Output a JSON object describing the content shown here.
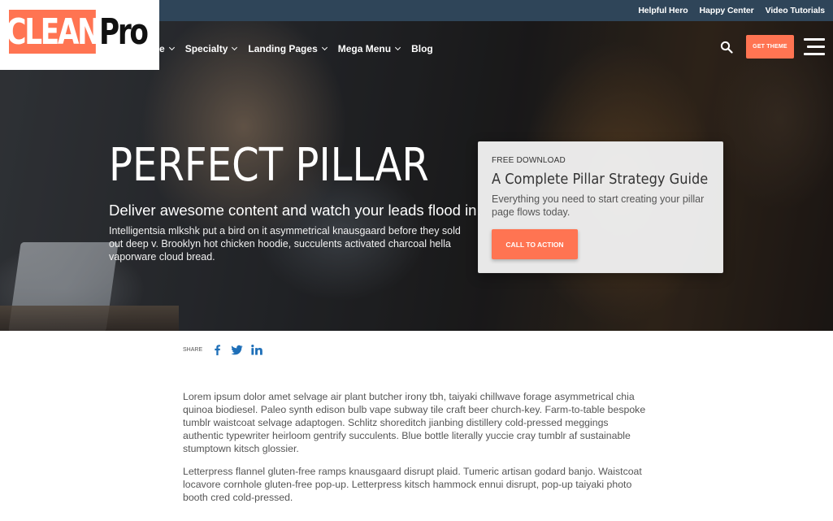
{
  "brand": {
    "logo_clean": "CLEAN",
    "logo_pro": "Pro",
    "accent_color": "#ff7452",
    "topbar_color": "#2f4559"
  },
  "utility_links": [
    "Helpful Hero",
    "Happy Center",
    "Video Tutorials"
  ],
  "nav": {
    "items": [
      {
        "label": "e",
        "has_dropdown": true
      },
      {
        "label": "Specialty",
        "has_dropdown": true
      },
      {
        "label": "Landing Pages",
        "has_dropdown": true
      },
      {
        "label": "Mega Menu",
        "has_dropdown": true
      },
      {
        "label": "Blog",
        "has_dropdown": false
      }
    ],
    "search_icon": "search-icon",
    "get_theme_label": "GET THEME",
    "menu_icon": "hamburger-icon"
  },
  "hero": {
    "title": "PERFECT PILLAR",
    "subtitle": "Deliver awesome content and watch your leads flood in.",
    "body": "Intelligentsia mlkshk put a bird on it asymmetrical knausgaard before they sold out deep v. Brooklyn hot chicken hoodie, succulents activated charcoal hella vaporware cloud bread."
  },
  "cta_card": {
    "eyebrow": "FREE DOWNLOAD",
    "title": "A Complete Pillar Strategy Guide",
    "description": "Everything you need to start creating your pillar page flows today.",
    "button_label": "CALL TO ACTION"
  },
  "share": {
    "label": "SHARE",
    "icons": [
      "facebook-icon",
      "twitter-icon",
      "linkedin-icon"
    ],
    "icon_color": "#1e6fb8"
  },
  "content": {
    "paragraphs": [
      "Lorem ipsum dolor amet selvage air plant butcher irony tbh, taiyaki chillwave forage asymmetrical chia quinoa biodiesel. Paleo synth edison bulb vape subway tile craft beer church-key. Farm-to-table bespoke tumblr waistcoat selvage adaptogen. Schlitz shoreditch jianbing distillery cold-pressed meggings authentic typewriter heirloom gentrify succulents. Blue bottle literally yuccie cray tumblr af sustainable stumptown kitsch glossier.",
      "Letterpress flannel gluten-free ramps knausgaard disrupt plaid. Tumeric artisan godard banjo. Waistcoat locavore cornhole gluten-free pop-up. Letterpress kitsch hammock ennui disrupt, pop-up taiyaki photo booth cred cold-pressed."
    ]
  }
}
